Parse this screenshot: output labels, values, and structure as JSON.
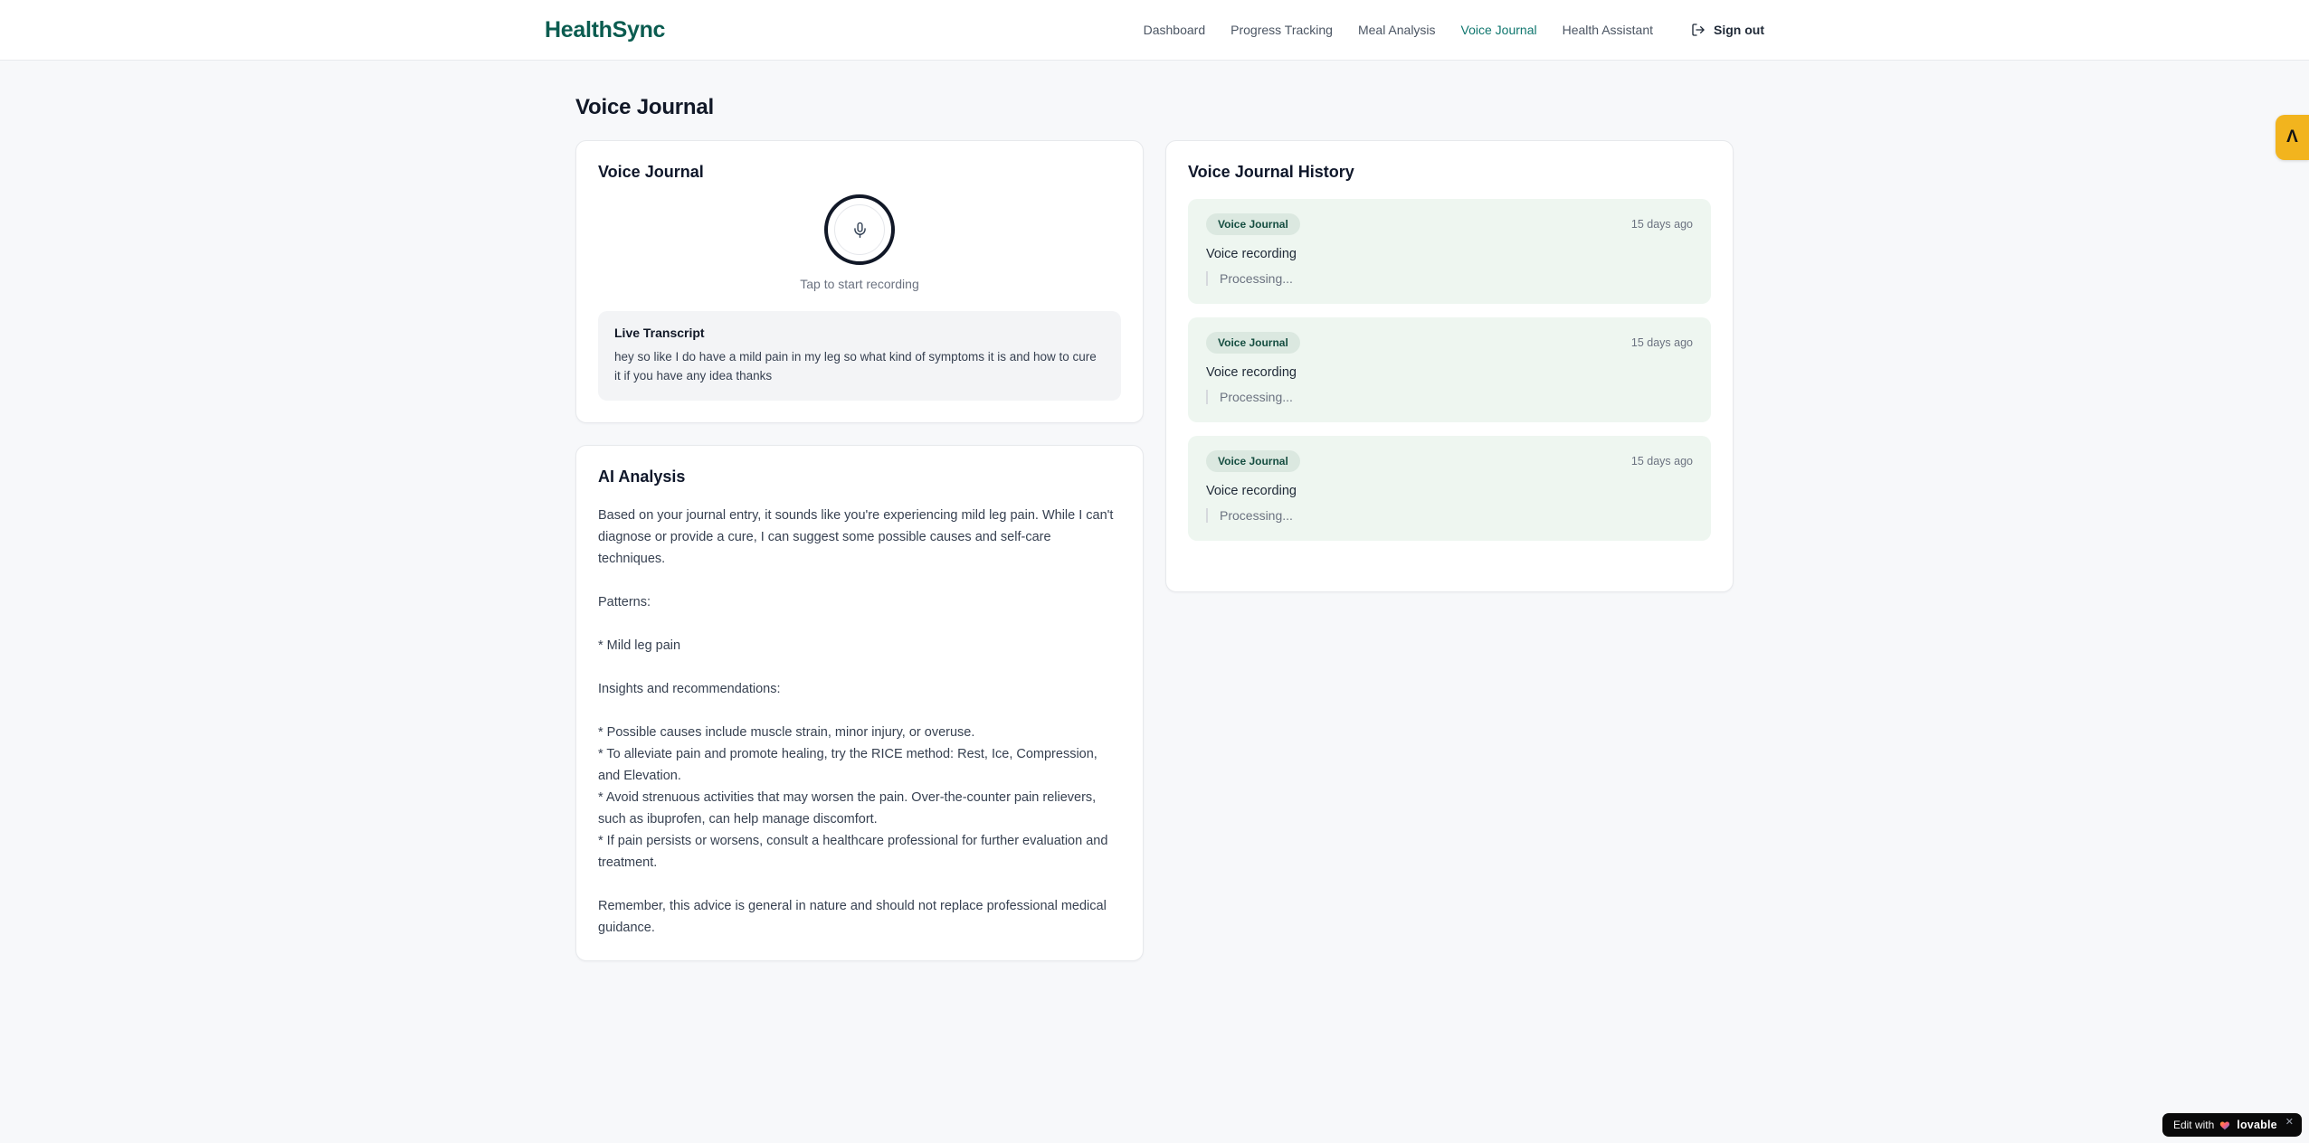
{
  "header": {
    "brand": "HealthSync",
    "nav": [
      {
        "label": "Dashboard",
        "active": false
      },
      {
        "label": "Progress Tracking",
        "active": false
      },
      {
        "label": "Meal Analysis",
        "active": false
      },
      {
        "label": "Voice Journal",
        "active": true
      },
      {
        "label": "Health Assistant",
        "active": false
      }
    ],
    "sign_out_label": "Sign out"
  },
  "page": {
    "title": "Voice Journal"
  },
  "recorder": {
    "card_title": "Voice Journal",
    "tap_hint": "Tap to start recording",
    "transcript_label": "Live Transcript",
    "transcript_text": "hey so like I do have a mild pain in my leg so what kind of symptoms it is and how to cure it if you have any idea thanks"
  },
  "analysis": {
    "card_title": "AI Analysis",
    "body": "Based on your journal entry, it sounds like you're experiencing mild leg pain. While I can't diagnose or provide a cure, I can suggest some possible causes and self-care techniques.\n\nPatterns:\n\n* Mild leg pain\n\nInsights and recommendations:\n\n* Possible causes include muscle strain, minor injury, or overuse.\n* To alleviate pain and promote healing, try the RICE method: Rest, Ice, Compression, and Elevation.\n* Avoid strenuous activities that may worsen the pain. Over-the-counter pain relievers, such as ibuprofen, can help manage discomfort.\n* If pain persists or worsens, consult a healthcare professional for further evaluation and treatment.\n\nRemember, this advice is general in nature and should not replace professional medical guidance."
  },
  "history": {
    "card_title": "Voice Journal History",
    "entries": [
      {
        "badge": "Voice Journal",
        "time": "15 days ago",
        "title": "Voice recording",
        "status": "Processing..."
      },
      {
        "badge": "Voice Journal",
        "time": "15 days ago",
        "title": "Voice recording",
        "status": "Processing..."
      },
      {
        "badge": "Voice Journal",
        "time": "15 days ago",
        "title": "Voice recording",
        "status": "Processing..."
      }
    ]
  },
  "overlays": {
    "side_badge_glyph": "Λ",
    "edit_badge": {
      "prefix": "Edit with",
      "brand": "lovable",
      "close": "✕"
    }
  },
  "colors": {
    "brand_teal": "#0b5c50",
    "nav_active": "#0f766e",
    "page_bg": "#f7f8fa",
    "entry_bg": "#eef6f0",
    "badge_bg": "#dbe8e0",
    "badge_text": "#164e41",
    "amber": "#f2b41e"
  }
}
